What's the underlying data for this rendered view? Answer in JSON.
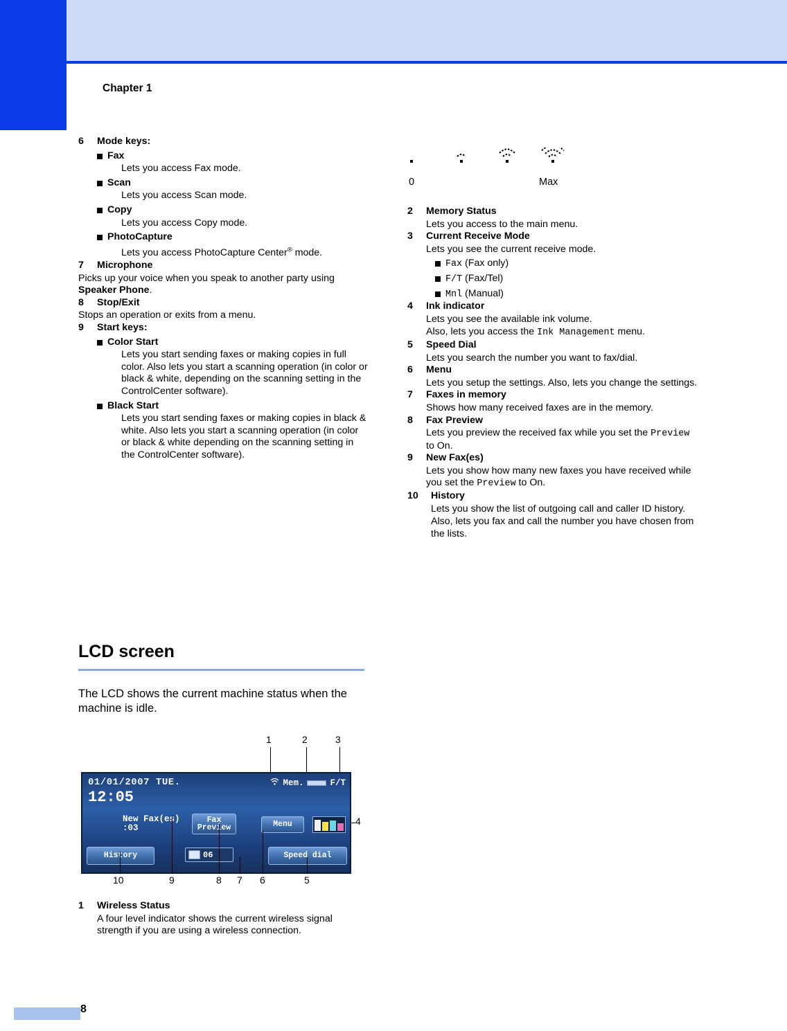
{
  "page": {
    "chapter": "Chapter 1",
    "page_number": "8"
  },
  "left_column": {
    "items": [
      {
        "num": "6",
        "title": "Mode keys:",
        "bullets": [
          {
            "label": "Fax",
            "desc": "Lets you access Fax mode."
          },
          {
            "label": "Scan",
            "desc": "Lets you access Scan mode."
          },
          {
            "label": "Copy",
            "desc": "Lets you access Copy mode."
          },
          {
            "label": "PhotoCapture",
            "desc": "Lets you access PhotoCapture Center® mode."
          }
        ]
      },
      {
        "num": "7",
        "title": "Microphone",
        "body_1": "Picks up your voice when you speak to another party using ",
        "body_bold": "Speaker Phone",
        "body_2": "."
      },
      {
        "num": "8",
        "title": "Stop/Exit",
        "body": "Stops an operation or exits from a menu."
      },
      {
        "num": "9",
        "title": "Start keys:",
        "bullets": [
          {
            "label": "Color Start",
            "desc": "Lets you start sending faxes or making copies in full color. Also lets you start a scanning operation (in color or black & white, depending on the scanning setting in the ControlCenter software)."
          },
          {
            "label": "Black Start",
            "desc": "Lets you start sending faxes or making copies in black & white. Also lets you start a scanning operation (in color or black & white depending on the scanning setting in the ControlCenter software)."
          }
        ]
      }
    ]
  },
  "section": {
    "heading": "LCD screen",
    "intro": "The LCD shows the current machine status when the machine is idle."
  },
  "lcd_figure": {
    "date": "01/01/2007 TUE.",
    "time": "12:05",
    "status_mem": "Mem.",
    "status_mode": "F/T",
    "new_fax_line1": "New Fax(es)",
    "new_fax_line2": ":03",
    "btn_fax_preview": "Fax\nPreview",
    "btn_menu": "Menu",
    "btn_history": "History",
    "btn_speed_dial": "Speed dial",
    "fax_mem_count": "06",
    "callouts_top": [
      "1",
      "2",
      "3"
    ],
    "callout_right": "4",
    "callouts_bottom": [
      "10",
      "9",
      "8",
      "7",
      "6",
      "5"
    ]
  },
  "lcd_items": [
    {
      "num": "1",
      "title": "Wireless Status",
      "body": "A four level indicator shows the current wireless signal strength if you are using a wireless connection."
    }
  ],
  "wifi_figure": {
    "min_label": "0",
    "max_label": "Max",
    "levels": [
      1,
      2,
      3,
      4
    ]
  },
  "right_column": {
    "items": [
      {
        "num": "2",
        "title": "Memory Status",
        "body": "Lets you access to the main menu."
      },
      {
        "num": "3",
        "title": "Current Receive Mode",
        "body": "Lets you see the current receive mode.",
        "bullets": [
          {
            "mono": "Fax",
            "rest": " (Fax only)"
          },
          {
            "mono": "F/T",
            "rest": " (Fax/Tel)"
          },
          {
            "mono": "Mnl",
            "rest": " (Manual)"
          }
        ]
      },
      {
        "num": "4",
        "title": "Ink indicator",
        "body": "Lets you see the available ink volume.",
        "body2_pre": "Also, lets you access the ",
        "body2_mono": "Ink Management",
        "body2_post": " menu."
      },
      {
        "num": "5",
        "title": "Speed Dial",
        "body": "Lets you search the number you want to fax/dial."
      },
      {
        "num": "6",
        "title": "Menu",
        "body": "Lets you setup the settings. Also, lets you change the settings."
      },
      {
        "num": "7",
        "title": "Faxes in memory",
        "body": "Shows how many received faxes are in the memory."
      },
      {
        "num": "8",
        "title": "Fax Preview",
        "body_pre": "Lets you preview the received fax while you set the ",
        "body_mono": "Preview",
        "body_post": " to On."
      },
      {
        "num": "9",
        "title": "New Fax(es)",
        "body_pre": "Lets you show how many new faxes you have received while you set the ",
        "body_mono": "Preview",
        "body_post": " to On."
      },
      {
        "num": "10",
        "title": "History",
        "body": "Lets you show the list of outgoing call and caller ID history.",
        "body2": "Also, lets you fax and call the number you have chosen from the lists."
      }
    ]
  },
  "colors": {
    "accent_blue": "#0b3ce8",
    "header_blue": "#ccdcf7",
    "rule_blue": "#8ca8e0"
  }
}
